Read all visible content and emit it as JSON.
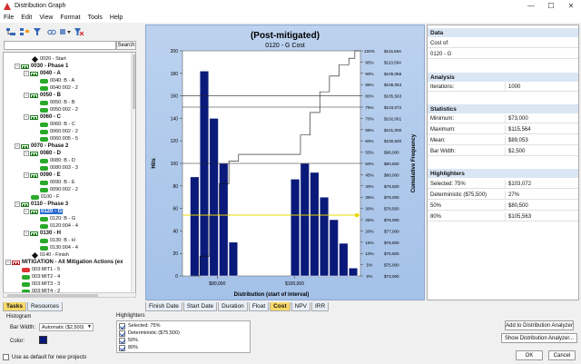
{
  "window": {
    "title": "Distribution Graph"
  },
  "menu": [
    "File",
    "Edit",
    "View",
    "Format",
    "Tools",
    "Help"
  ],
  "search": {
    "button": "Search",
    "value": ""
  },
  "tree": [
    {
      "label": "0020 - Start",
      "indent": 2,
      "icon": "diamond"
    },
    {
      "label": "0030 - Phase 1",
      "indent": 1,
      "icon": "milestone-green",
      "bold": true,
      "expander": "-"
    },
    {
      "label": "0040 - A",
      "indent": 2,
      "icon": "milestone-green",
      "bold": true,
      "expander": "-"
    },
    {
      "label": "0040: B - A",
      "indent": 3,
      "icon": "green"
    },
    {
      "label": "0040:002 - 2",
      "indent": 3,
      "icon": "green"
    },
    {
      "label": "0050 - B",
      "indent": 2,
      "icon": "milestone-green",
      "bold": true,
      "expander": "-"
    },
    {
      "label": "0050: B - B",
      "indent": 3,
      "icon": "green"
    },
    {
      "label": "0050:002 - 2",
      "indent": 3,
      "icon": "green"
    },
    {
      "label": "0060 - C",
      "indent": 2,
      "icon": "milestone-green",
      "bold": true,
      "expander": "-"
    },
    {
      "label": "0060: B - C",
      "indent": 3,
      "icon": "green"
    },
    {
      "label": "0060:002 - 2",
      "indent": 3,
      "icon": "green"
    },
    {
      "label": "0060:005 - 5",
      "indent": 3,
      "icon": "green"
    },
    {
      "label": "0070 - Phase 2",
      "indent": 1,
      "icon": "milestone-green",
      "bold": true,
      "expander": "-"
    },
    {
      "label": "0080 - D",
      "indent": 2,
      "icon": "milestone-green",
      "bold": true,
      "expander": "-"
    },
    {
      "label": "0080: B - D",
      "indent": 3,
      "icon": "green"
    },
    {
      "label": "0080:003 - 3",
      "indent": 3,
      "icon": "green"
    },
    {
      "label": "0090 - E",
      "indent": 2,
      "icon": "milestone-green",
      "bold": true,
      "expander": "-"
    },
    {
      "label": "0090: B - E",
      "indent": 3,
      "icon": "green"
    },
    {
      "label": "0090:002 - 2",
      "indent": 3,
      "icon": "green"
    },
    {
      "label": "0100 - F",
      "indent": 2,
      "icon": "green"
    },
    {
      "label": "0110 - Phase 3",
      "indent": 1,
      "icon": "milestone-green",
      "bold": true,
      "expander": "-"
    },
    {
      "label": "0120 - G",
      "indent": 2,
      "icon": "milestone-green",
      "bold": true,
      "expander": "-",
      "selected": true
    },
    {
      "label": "0120: B - G",
      "indent": 3,
      "icon": "green"
    },
    {
      "label": "0120:004 - 4",
      "indent": 3,
      "icon": "green"
    },
    {
      "label": "0130 - H",
      "indent": 2,
      "icon": "milestone-green",
      "bold": true,
      "expander": "-"
    },
    {
      "label": "0130: B - H",
      "indent": 3,
      "icon": "green"
    },
    {
      "label": "0130:004 - 4",
      "indent": 3,
      "icon": "green"
    },
    {
      "label": "0140 - Finish",
      "indent": 2,
      "icon": "diamond"
    },
    {
      "label": "MITIGATION - All Mitigation Actions (ex",
      "indent": 0,
      "icon": "milestone-red",
      "bold": true,
      "expander": "-"
    },
    {
      "label": "003:MIT1 - 5",
      "indent": 1,
      "icon": "red"
    },
    {
      "label": "003:MIT2 - 4",
      "indent": 1,
      "icon": "green"
    },
    {
      "label": "003:MIT3 - 3",
      "indent": 1,
      "icon": "green"
    },
    {
      "label": "003:MIT4 - 2",
      "indent": 1,
      "icon": "green"
    }
  ],
  "left_tabs": [
    "Tasks",
    "Resources"
  ],
  "histogram": {
    "title": "Histogram",
    "bar_width_label": "Bar Width:",
    "bar_width_value": "Automatic ($2,500)",
    "color_label": "Color:",
    "color": "#0a1a7a"
  },
  "default_checkbox": "Use as default for new projects",
  "chart_tabs": [
    "Finish Date",
    "Start Date",
    "Duration",
    "Float",
    "Cost",
    "NPV",
    "IRR"
  ],
  "chart_tab_active": "Cost",
  "highlighters_group": {
    "title": "Highlighters",
    "items": [
      "Selected: 75%",
      "Deterministic ($75,500)",
      "50%",
      "80%"
    ]
  },
  "buttons": {
    "add": "Add to Distribution Analyzer",
    "show": "Show Distribution Analyzer...",
    "ok": "OK",
    "cancel": "Cancel"
  },
  "stats": {
    "data_header": "Data",
    "cost_of_label": "Cost of:",
    "cost_of_value": "0120 - G",
    "analysis_header": "Analysis",
    "iterations_label": "Iterations:",
    "iterations_value": "1000",
    "statistics_header": "Statistics",
    "minimum_label": "Minimum:",
    "minimum_value": "$73,000",
    "maximum_label": "Maximum:",
    "maximum_value": "$115,564",
    "mean_label": "Mean:",
    "mean_value": "$89,053",
    "barwidth_label": "Bar Width:",
    "barwidth_value": "$2,500",
    "highlighters_header": "Highlighters",
    "hl": [
      {
        "label": "Selected: 75%",
        "value": "$103,072"
      },
      {
        "label": "Deterministic ($75,500)",
        "value": "27%"
      },
      {
        "label": "50%",
        "value": "$80,500"
      },
      {
        "label": "80%",
        "value": "$105,563"
      }
    ]
  },
  "chart_data": {
    "type": "bar",
    "title": "(Post-mitigated)",
    "subtitle": "0120 - G    Cost",
    "xlabel": "Distribution (start of interval)",
    "ylabel": "Hits",
    "y2label": "Cumulative Frequency",
    "ylim": [
      0,
      200
    ],
    "yticks": [
      0,
      20,
      40,
      60,
      80,
      100,
      120,
      140,
      160,
      180,
      200
    ],
    "xlim": [
      71000,
      117000
    ],
    "xticks": [
      {
        "value": 80000,
        "label": "$80,000"
      },
      {
        "value": 100000,
        "label": "$100,000"
      }
    ],
    "bar_width": 2500,
    "x": [
      73000,
      75500,
      78000,
      80500,
      83000,
      99000,
      101500,
      104000,
      106500,
      109000,
      111500,
      114000
    ],
    "values": [
      88,
      182,
      140,
      100,
      30,
      86,
      100,
      92,
      70,
      50,
      29,
      7
    ],
    "bar_color": "#0a1a7a",
    "cumulative_line": {
      "x": [
        73000,
        75500,
        78000,
        80500,
        83000,
        85500,
        99000,
        101500,
        104000,
        106500,
        109000,
        111500,
        114000,
        115564
      ],
      "y": [
        0,
        8.8,
        27,
        41,
        51,
        54,
        54,
        62.6,
        72.6,
        81.8,
        88.8,
        93.8,
        96.7,
        100
      ]
    },
    "right_axis": [
      {
        "pct": "0%",
        "val": "$73,000"
      },
      {
        "pct": "5%",
        "val": "$75,000"
      },
      {
        "pct": "10%",
        "val": "$75,500"
      },
      {
        "pct": "15%",
        "val": "$76,500"
      },
      {
        "pct": "20%",
        "val": "$77,000"
      },
      {
        "pct": "25%",
        "val": "$78,000"
      },
      {
        "pct": "30%",
        "val": "$78,500"
      },
      {
        "pct": "35%",
        "val": "$79,000"
      },
      {
        "pct": "40%",
        "val": "$79,500"
      },
      {
        "pct": "45%",
        "val": "$80,000"
      },
      {
        "pct": "50%",
        "val": "$80,500"
      },
      {
        "pct": "55%",
        "val": "$98,000"
      },
      {
        "pct": "60%",
        "val": "$100,500"
      },
      {
        "pct": "65%",
        "val": "$101,000"
      },
      {
        "pct": "70%",
        "val": "$102,061"
      },
      {
        "pct": "75%",
        "val": "$103,072"
      },
      {
        "pct": "80%",
        "val": "$105,563"
      },
      {
        "pct": "85%",
        "val": "$108,053"
      },
      {
        "pct": "90%",
        "val": "$109,058"
      },
      {
        "pct": "95%",
        "val": "$110,564"
      },
      {
        "pct": "100%",
        "val": "$115,564"
      }
    ],
    "highlight_lines": [
      {
        "pct": 27,
        "color": "#e8d800",
        "marker": true
      },
      {
        "pct": 50,
        "color": "#222222"
      },
      {
        "pct": 75,
        "color": "#222222"
      },
      {
        "pct": 80,
        "color": "#222222"
      }
    ]
  }
}
